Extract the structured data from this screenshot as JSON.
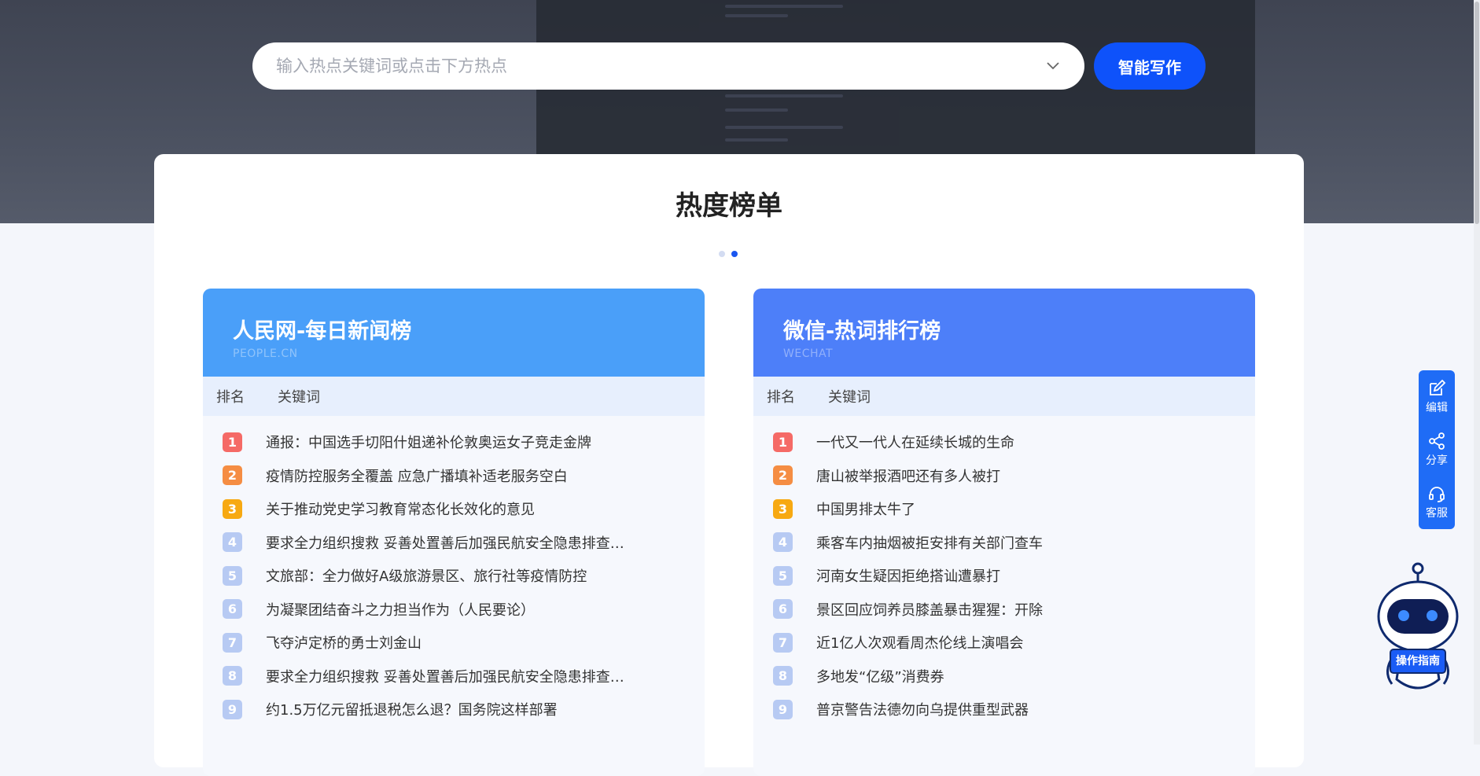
{
  "search": {
    "placeholder": "输入热点关键词或点击下方热点"
  },
  "write_button": "智能写作",
  "section_title": "热度榜单",
  "boards": [
    {
      "title": "人民网-每日新闻榜",
      "subtitle": "PEOPLE.CN",
      "col_rank": "排名",
      "col_keyword": "关键词",
      "items": [
        {
          "rank": "1",
          "text": "通报：中国选手切阳什姐递补伦敦奥运女子竞走金牌"
        },
        {
          "rank": "2",
          "text": "疫情防控服务全覆盖 应急广播填补适老服务空白"
        },
        {
          "rank": "3",
          "text": "关于推动党史学习教育常态化长效化的意见"
        },
        {
          "rank": "4",
          "text": "要求全力组织搜救  妥善处置善后加强民航安全隐患排查  ..."
        },
        {
          "rank": "5",
          "text": "文旅部：全力做好A级旅游景区、旅行社等疫情防控"
        },
        {
          "rank": "6",
          "text": "为凝聚团结奋斗之力担当作为（人民要论）"
        },
        {
          "rank": "7",
          "text": "飞夺泸定桥的勇士刘金山"
        },
        {
          "rank": "8",
          "text": "要求全力组织搜救  妥善处置善后加强民航安全隐患排查  ..."
        },
        {
          "rank": "9",
          "text": "约1.5万亿元留抵退税怎么退？国务院这样部署"
        }
      ]
    },
    {
      "title": "微信-热词排行榜",
      "subtitle": "WECHAT",
      "col_rank": "排名",
      "col_keyword": "关键词",
      "items": [
        {
          "rank": "1",
          "text": "一代又一代人在延续长城的生命"
        },
        {
          "rank": "2",
          "text": "唐山被举报酒吧还有多人被打"
        },
        {
          "rank": "3",
          "text": "中国男排太牛了"
        },
        {
          "rank": "4",
          "text": "乘客车内抽烟被拒安排有关部门查车"
        },
        {
          "rank": "5",
          "text": "河南女生疑因拒绝搭讪遭暴打"
        },
        {
          "rank": "6",
          "text": "景区回应饲养员膝盖暴击猩猩：开除"
        },
        {
          "rank": "7",
          "text": "近1亿人次观看周杰伦线上演唱会"
        },
        {
          "rank": "8",
          "text": "多地发“亿级”消费券"
        },
        {
          "rank": "9",
          "text": "普京警告法德勿向乌提供重型武器"
        }
      ]
    }
  ],
  "float_bar": {
    "edit": "编辑",
    "share": "分享",
    "service": "客服"
  },
  "robot_label": "操作指南",
  "colors": {
    "primary": "#0e52fa",
    "board_left": "#4a9ff9",
    "board_right": "#4d7ff9",
    "rank1": "#f56a66",
    "rank2": "#f58d43",
    "rank3": "#f7a912",
    "rank_other": "#b7caf3"
  }
}
